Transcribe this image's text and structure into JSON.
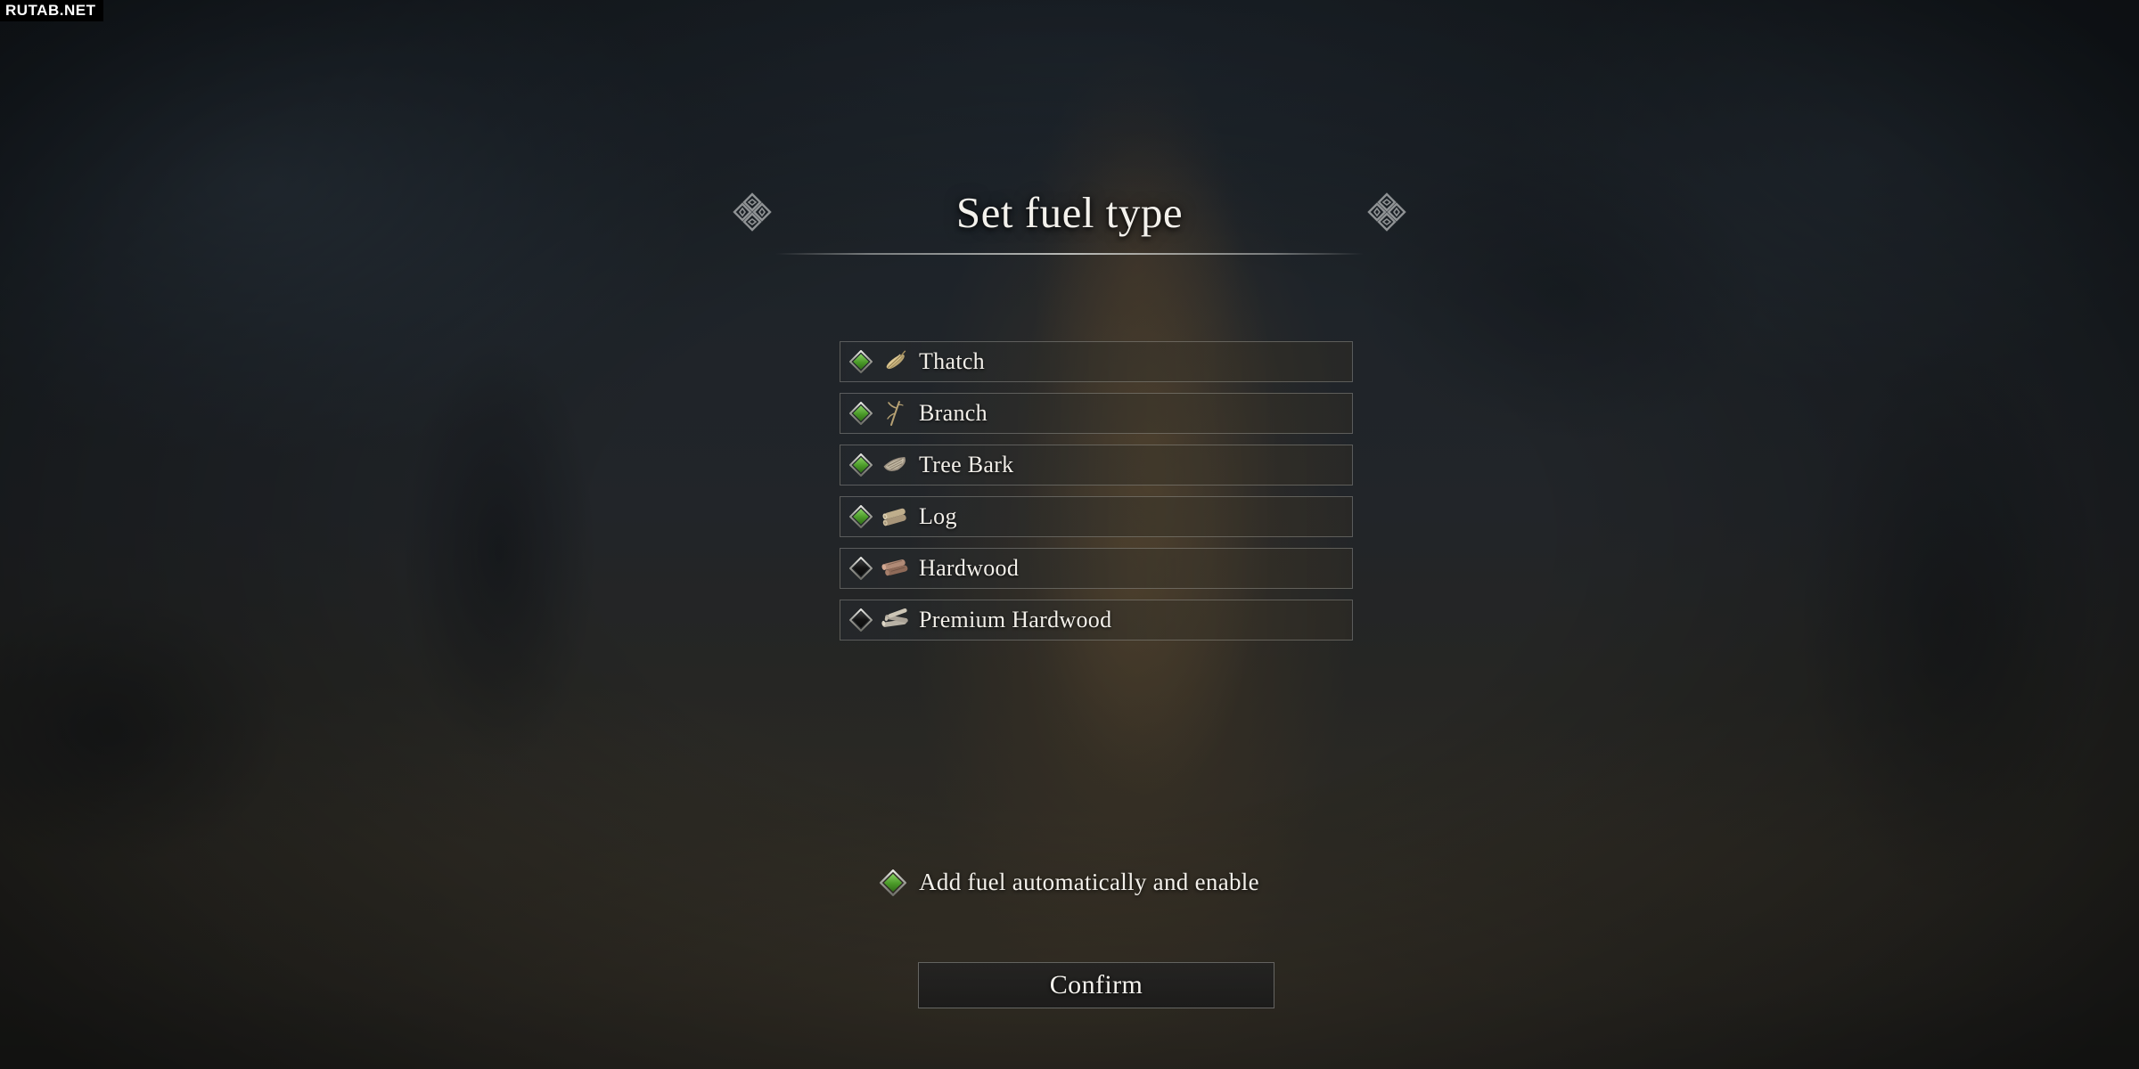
{
  "watermark": {
    "text": "RUTAB.NET"
  },
  "dialog": {
    "title": "Set fuel type",
    "ornament_left_name": "diamond-cluster-ornament",
    "ornament_right_name": "diamond-cluster-ornament"
  },
  "fuel_options": [
    {
      "label": "Thatch",
      "checked": true,
      "icon": "thatch-icon"
    },
    {
      "label": "Branch",
      "checked": true,
      "icon": "branch-icon"
    },
    {
      "label": "Tree Bark",
      "checked": true,
      "icon": "tree-bark-icon"
    },
    {
      "label": "Log",
      "checked": true,
      "icon": "log-icon"
    },
    {
      "label": "Hardwood",
      "checked": false,
      "icon": "hardwood-icon"
    },
    {
      "label": "Premium Hardwood",
      "checked": false,
      "icon": "premium-hardwood-icon"
    }
  ],
  "auto_fuel": {
    "label": "Add fuel automatically and enable",
    "checked": true
  },
  "confirm": {
    "label": "Confirm"
  },
  "colors": {
    "checkbox_checked_fill": "#4a9a28",
    "checkbox_checked_highlight": "#86d060",
    "checkbox_unchecked_fill": "#121212",
    "checkbox_border": "#c2c2bc",
    "row_border": "#c4c4be",
    "text_primary": "#f2efe9",
    "background_top": "#252c33",
    "background_bottom": "#3a362e"
  }
}
